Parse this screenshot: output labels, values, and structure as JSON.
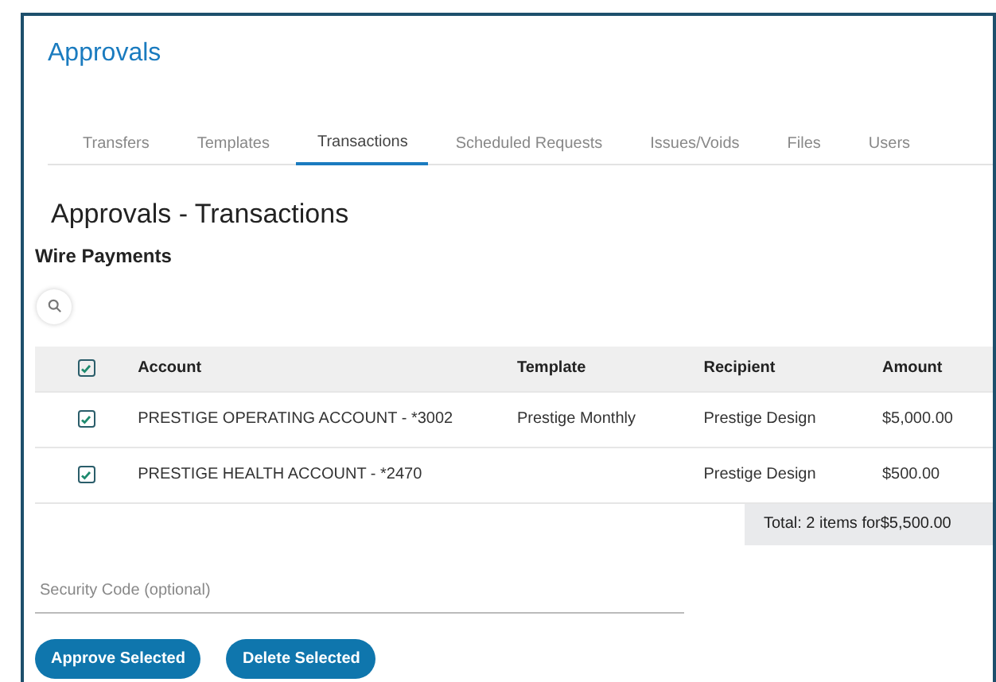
{
  "page": {
    "title": "Approvals"
  },
  "tabs": [
    {
      "label": "Transfers",
      "selected": false
    },
    {
      "label": "Templates",
      "selected": false
    },
    {
      "label": "Transactions",
      "selected": true
    },
    {
      "label": "Scheduled Requests",
      "selected": false
    },
    {
      "label": "Issues/Voids",
      "selected": false
    },
    {
      "label": "Files",
      "selected": false
    },
    {
      "label": "Users",
      "selected": false
    }
  ],
  "heading": "Approvals - Transactions",
  "section": "Wire Payments",
  "table": {
    "select_all": {
      "checked": true
    },
    "columns": [
      "Account",
      "Template",
      "Recipient",
      "Amount"
    ],
    "rows": [
      {
        "checked": true,
        "cells": [
          "PRESTIGE OPERATING ACCOUNT - *3002",
          "Prestige Monthly",
          "Prestige Design",
          "$5,000.00"
        ]
      },
      {
        "checked": true,
        "cells": [
          "PRESTIGE HEALTH ACCOUNT - *2470",
          "",
          "Prestige Design",
          "$500.00"
        ]
      }
    ],
    "total": "Total: 2 items for$5,500.00"
  },
  "security_code": {
    "placeholder": "Security Code (optional)"
  },
  "buttons": [
    "Approve Selected",
    "Delete Selected"
  ]
}
